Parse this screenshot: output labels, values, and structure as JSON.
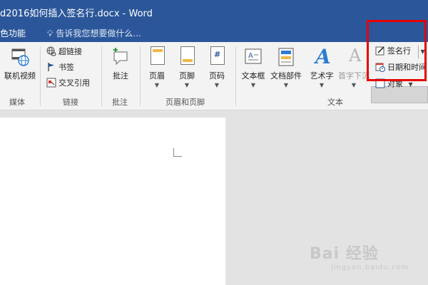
{
  "window": {
    "title": "d2016如何插入签名行.docx - Word"
  },
  "tellbar": {
    "tab_label": "色功能",
    "tell_me": "告诉我您想要做什么..."
  },
  "ribbon": {
    "media": {
      "online_video": "联机视频",
      "group": "媒体"
    },
    "links": {
      "hyperlink": "超链接",
      "bookmark": "书签",
      "cross_reference": "交叉引用",
      "group": "链接"
    },
    "comments": {
      "comment": "批注",
      "group": "批注"
    },
    "header_footer": {
      "header": "页眉",
      "footer": "页脚",
      "page_number": "页码",
      "group": "页眉和页脚"
    },
    "text": {
      "text_box": "文本框",
      "quick_parts": "文档部件",
      "wordart": "艺术字",
      "drop_cap": "首字下沉",
      "group": "文本",
      "signature_line": "签名行",
      "date_time": "日期和时间",
      "object": "对象"
    }
  },
  "watermark": {
    "main": "Bai 经验",
    "sub": "jingyan.baidu.com"
  },
  "colors": {
    "title_bar": "#2b579a",
    "highlight": "#e60000"
  }
}
